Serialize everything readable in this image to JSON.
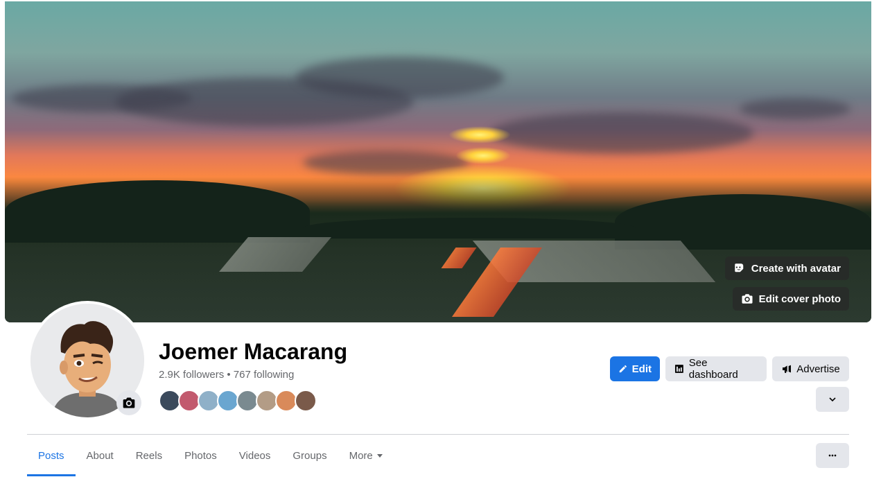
{
  "cover": {
    "create_avatar_label": "Create with avatar",
    "edit_cover_label": "Edit cover photo"
  },
  "profile": {
    "name": "Joemer Macarang",
    "followers_line": "2.9K followers • 767 following",
    "friend_colors": [
      "#3b4a5c",
      "#c25a6e",
      "#8fb0c8",
      "#6aa6d0",
      "#7a8a90",
      "#b39c86",
      "#d98a5a",
      "#7a5a4a"
    ]
  },
  "actions": {
    "edit_label": "Edit",
    "dashboard_label": "See dashboard",
    "advertise_label": "Advertise"
  },
  "tabs": [
    {
      "label": "Posts",
      "active": true
    },
    {
      "label": "About"
    },
    {
      "label": "Reels"
    },
    {
      "label": "Photos"
    },
    {
      "label": "Videos"
    },
    {
      "label": "Groups"
    },
    {
      "label": "More"
    }
  ],
  "colors": {
    "accent": "#1b74e4",
    "secondary_button": "#e4e6eb",
    "muted_text": "#65676b"
  }
}
